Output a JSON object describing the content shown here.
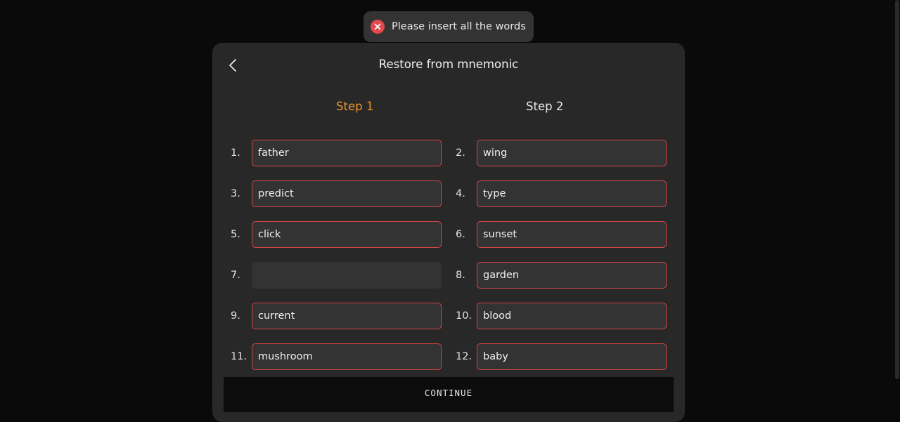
{
  "toast": {
    "icon": "error-x-icon",
    "icon_color": "#e5484d",
    "message": "Please insert all the words"
  },
  "modal": {
    "title": "Restore from mnemonic",
    "back_icon": "chevron-left-icon"
  },
  "steps": [
    {
      "label": "Step 1",
      "active": true,
      "color": "#f0932b"
    },
    {
      "label": "Step 2",
      "active": false,
      "color": "#eaeaea"
    }
  ],
  "words": [
    {
      "num": "1.",
      "value": "father"
    },
    {
      "num": "2.",
      "value": "wing"
    },
    {
      "num": "3.",
      "value": "predict"
    },
    {
      "num": "4.",
      "value": "type"
    },
    {
      "num": "5.",
      "value": "click"
    },
    {
      "num": "6.",
      "value": "sunset"
    },
    {
      "num": "7.",
      "value": ""
    },
    {
      "num": "8.",
      "value": "garden"
    },
    {
      "num": "9.",
      "value": "current"
    },
    {
      "num": "10.",
      "value": "blood"
    },
    {
      "num": "11.",
      "value": "mushroom"
    },
    {
      "num": "12.",
      "value": "baby"
    }
  ],
  "footer": {
    "continue_label": "CONTINUE"
  },
  "colors": {
    "error_border": "#d64545",
    "accent": "#f0932b",
    "panel": "#282828",
    "input_bg": "#333333"
  }
}
